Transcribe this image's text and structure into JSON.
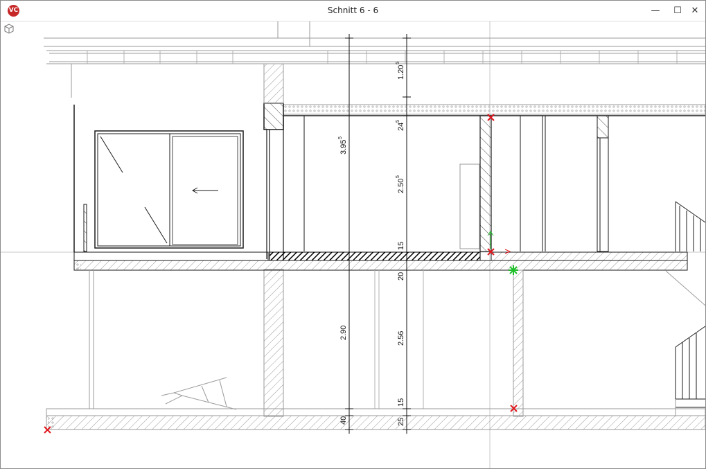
{
  "window": {
    "title": "Schnitt 6 - 6",
    "app_logo": "VC",
    "controls": {
      "minimize": "—",
      "maximize": "☐",
      "close": "✕"
    }
  },
  "toolbar": {
    "view_cube_icon": "view-cube-icon"
  },
  "dimensions": {
    "left_chain": {
      "upper": "3.95",
      "upper_sup": "5",
      "lower": "2.90",
      "base": "40"
    },
    "right_chain": {
      "roof": "1.20",
      "roof_sup": "5",
      "ceiling": "24",
      "ceiling_sup": "5",
      "room_upper": "2.50",
      "room_upper_sup": "5",
      "floor_upper": "15",
      "slab": "20",
      "room_lower": "2.56",
      "floor_lower": "15",
      "base": "25"
    }
  },
  "colors": {
    "marker_red": "#e0191f",
    "marker_green": "#1fbf2a",
    "line": "#1a1a1a",
    "light_line": "#9a9a9a",
    "hatch": "#8a8a8a"
  }
}
